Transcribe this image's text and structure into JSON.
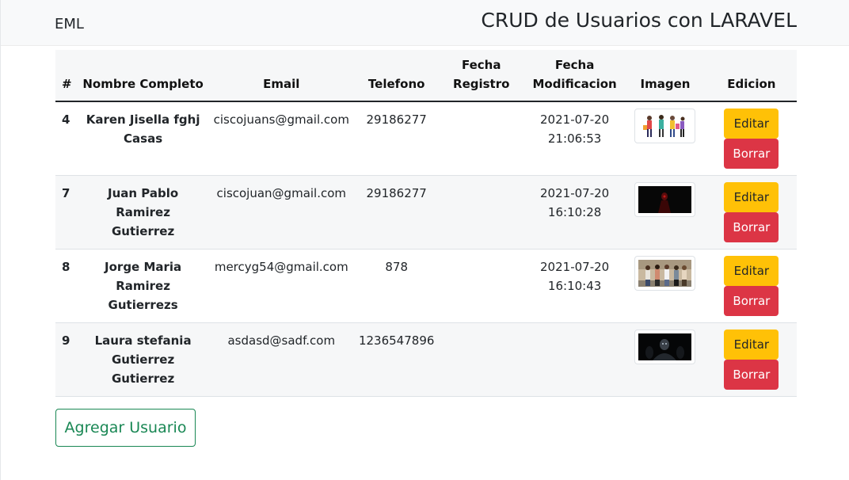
{
  "nav": {
    "brand": "EML",
    "title": "CRUD de Usuarios con LARAVEL"
  },
  "table": {
    "headers": {
      "id": "#",
      "name": "Nombre Completo",
      "email": "Email",
      "phone": "Telefono",
      "created_1": "Fecha",
      "created_2": "Registro",
      "modified_1": "Fecha",
      "modified_2": "Modificacion",
      "image": "Imagen",
      "actions": "Edicion"
    },
    "rows": [
      {
        "id": "4",
        "name_1": "Karen Jisella fghj",
        "name_2": "Casas",
        "email": "ciscojuans@gmail.com",
        "phone": "29186277",
        "created": "",
        "modified_1": "2021-07-20",
        "modified_2": "21:06:53",
        "image": "people-shopping-illustration"
      },
      {
        "id": "7",
        "name_1": "Juan Pablo Ramirez",
        "name_2": "Gutierrez",
        "email": "ciscojuan@gmail.com",
        "phone": "29186277",
        "created": "",
        "modified_1": "2021-07-20",
        "modified_2": "16:10:28",
        "image": "dark-red-figure-photo"
      },
      {
        "id": "8",
        "name_1": "Jorge Maria Ramirez",
        "name_2": "Gutierrezs",
        "email": "mercyg54@gmail.com",
        "phone": "878",
        "created": "",
        "modified_1": "2021-07-20",
        "modified_2": "16:10:43",
        "image": "group-of-people-street-photo"
      },
      {
        "id": "9",
        "name_1": "Laura stefania",
        "name_2": "Gutierrez Gutierrez",
        "email": "asdasd@sadf.com",
        "phone": "1236547896",
        "created": "",
        "modified_1": "",
        "modified_2": "",
        "image": "dark-figures-photo"
      }
    ],
    "edit_label": "Editar",
    "delete_label": "Borrar"
  },
  "add_button": "Agregar Usuario",
  "colors": {
    "edit": "#ffc107",
    "delete": "#dc3545",
    "add": "#198754"
  }
}
